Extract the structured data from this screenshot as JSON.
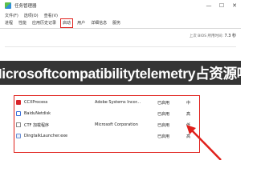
{
  "window": {
    "title": "任务管理器",
    "controls": {
      "minimize": "—",
      "maximize": "☐",
      "close": "✕"
    }
  },
  "menu": [
    "文件(F)",
    "选项(O)",
    "查看(V)"
  ],
  "tabs": [
    "进程",
    "性能",
    "应用历史记录",
    "启动",
    "用户",
    "详细信息",
    "服务"
  ],
  "active_tab": "启动",
  "bios": {
    "label": "上次 BIOS 所用时间:",
    "value": "7.3 秒"
  },
  "banner": "Microsoftcompatibilitytelemetry占资源吗",
  "processes": [
    {
      "name": "CCXProcess",
      "publisher": "Adobe Systems Incor...",
      "status": "已启用",
      "impact": "中",
      "icon": "ccx-icon"
    },
    {
      "name": "BaiduNetdisk",
      "publisher": "",
      "status": "已启用",
      "impact": "高",
      "icon": "baidu-icon"
    },
    {
      "name": "CTF 加载程序",
      "publisher": "Microsoft Corporation",
      "status": "已启用",
      "impact": "低",
      "icon": "ctf-icon"
    },
    {
      "name": "DingtalkLauncher.exe",
      "publisher": "",
      "status": "已启用",
      "impact": "高",
      "icon": "ding-icon"
    }
  ],
  "colors": {
    "highlight": "#e0201b",
    "banner_bg": "#282828",
    "banner_text": "#ffffff"
  }
}
